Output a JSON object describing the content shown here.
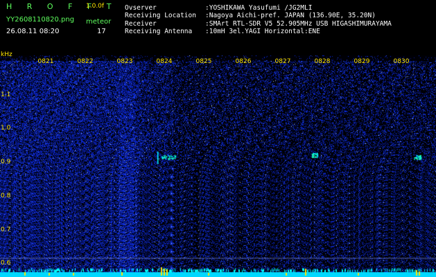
{
  "header": {
    "app_name": "H R O F F T",
    "version": "1.0.0f",
    "file_name": "YY2608110820.png",
    "timestamp": "26.08.11 08:20",
    "mode_label": "meteor",
    "count": "17"
  },
  "station": {
    "fields": [
      {
        "key": "Ovserver",
        "value": ":YOSHIKAWA Yasufumi /JG2MLI"
      },
      {
        "key": "Receiving Location",
        "value": ":Nagoya Aichi-pref. JAPAN (136.90E, 35.20N)"
      },
      {
        "key": "Receiver",
        "value": ":SMArt RTL-SDR V5 52.905MHz USB HIGASHIMURAYAMA"
      },
      {
        "key": "Receiving Antenna",
        "value": ":10mH 3el.YAGI Horizontal:ENE"
      }
    ]
  },
  "chart_data": {
    "type": "heatmap",
    "ylabel": "kHz",
    "yticks": [
      "1.1",
      "1.0",
      "0.9",
      "0.8",
      "0.7",
      "0.6"
    ],
    "xticks": [
      "0821",
      "0822",
      "0823",
      "0824",
      "0825",
      "0826",
      "0827",
      "0828",
      "0829",
      "0830"
    ],
    "ylim": [
      0.58,
      1.2
    ],
    "grid": false
  },
  "colors": {
    "background": "#000000",
    "noise": "#1b2cff",
    "signal": "#00ffff",
    "tick_label": "#ffe600",
    "title_green": "#5eff5e"
  }
}
